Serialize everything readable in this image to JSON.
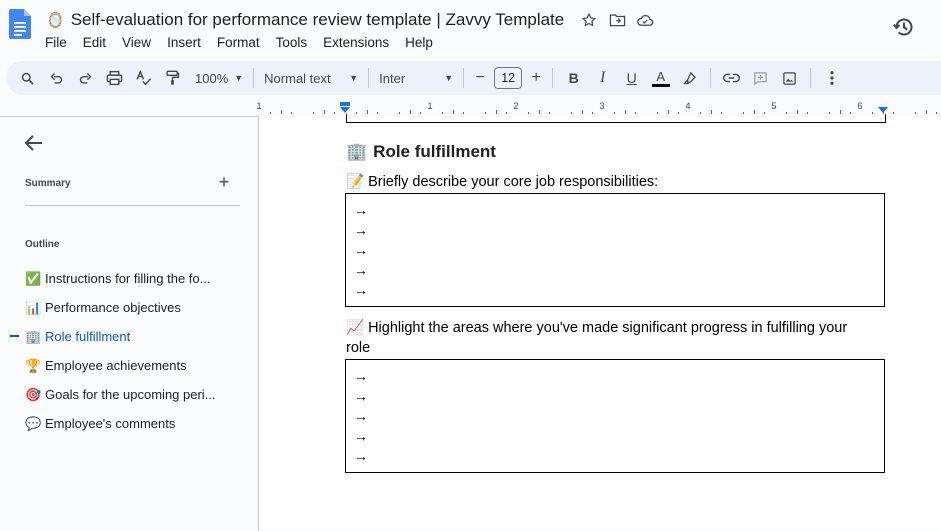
{
  "title_bar": {
    "emoji": "🪞",
    "doc_title": "Self-evaluation for performance review template | Zavvy Template"
  },
  "menu": [
    "File",
    "Edit",
    "View",
    "Insert",
    "Format",
    "Tools",
    "Extensions",
    "Help"
  ],
  "toolbar": {
    "zoom": "100%",
    "style": "Normal text",
    "font": "Inter",
    "font_size": "12",
    "bold": "B",
    "italic": "I",
    "underline": "U",
    "text_color": "A",
    "minus": "−",
    "plus": "+"
  },
  "ruler": {
    "labels": [
      "1",
      "1",
      "2",
      "3",
      "4",
      "5",
      "6"
    ]
  },
  "sidebar": {
    "summary_label": "Summary",
    "add": "+",
    "outline_label": "Outline",
    "items": [
      {
        "emoji": "✅",
        "label": "Instructions for filling the fo..."
      },
      {
        "emoji": "📊",
        "label": "Performance objectives"
      },
      {
        "emoji": "🏢",
        "label": "Role fulfillment"
      },
      {
        "emoji": "🏆",
        "label": "Employee achievements"
      },
      {
        "emoji": "🎯",
        "label": "Goals for the upcoming peri..."
      },
      {
        "emoji": "💬",
        "label": "Employee's comments"
      }
    ],
    "active_index": 2
  },
  "document": {
    "heading_emoji": "🏢",
    "heading": "Role fulfillment",
    "q1_emoji": "📝",
    "q1": "Briefly describe your core job responsibilities:",
    "q2_emoji": "📈",
    "q2_line1": "Highlight the areas where you've made significant progress in fulfilling your",
    "q2_line2": "role",
    "arrow": "→"
  },
  "colors": {
    "accent": "#0b57d0",
    "toolbar_bg": "#edf2fa",
    "app_bg": "#f9fbfd"
  }
}
